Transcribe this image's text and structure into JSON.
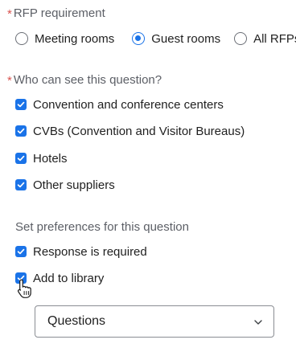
{
  "rfp_requirement": {
    "label": "RFP requirement",
    "required_mark": "*",
    "options": [
      {
        "label": "Meeting rooms",
        "selected": false
      },
      {
        "label": "Guest rooms",
        "selected": true
      },
      {
        "label": "All RFPs",
        "selected": false
      }
    ]
  },
  "visibility": {
    "label": "Who can see this question?",
    "required_mark": "*",
    "options": [
      {
        "label": "Convention and conference centers",
        "checked": true
      },
      {
        "label": "CVBs (Convention and Visitor Bureaus)",
        "checked": true
      },
      {
        "label": "Hotels",
        "checked": true
      },
      {
        "label": "Other suppliers",
        "checked": true
      }
    ]
  },
  "preferences": {
    "label": "Set preferences for this question",
    "options": [
      {
        "label": "Response is required",
        "checked": true
      },
      {
        "label": "Add to library",
        "checked": true
      }
    ]
  },
  "library_select": {
    "value": "Questions"
  },
  "colors": {
    "accent": "#1a73e8",
    "required": "#d9534f",
    "muted_text": "#5c5f66"
  }
}
